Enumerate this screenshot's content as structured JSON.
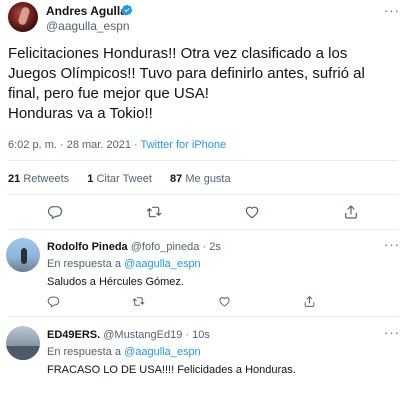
{
  "tweet": {
    "author_name": "Andres Agulla",
    "handle": "@aagulla_espn",
    "text_lines": [
      "Felicitaciones Honduras!! Otra vez clasificado a los",
      "Juegos Olímpicos!! Tuvo para definirlo antes, sufrió al",
      "final, pero fue mejor que USA!",
      "Honduras va a Tokio!!"
    ],
    "time": "6:02 p. m.",
    "date": "28 mar. 2021",
    "source": "Twitter for iPhone",
    "meta_separator": "·",
    "stats": {
      "retweets_count": "21",
      "retweets_label": "Retweets",
      "quotes_count": "1",
      "quotes_label": "Citar Tweet",
      "likes_count": "87",
      "likes_label": "Me gusta"
    },
    "more_glyph": "···"
  },
  "replies": [
    {
      "name": "Rodolfo Pineda",
      "handle": "@fofo_pineda",
      "time": "2s",
      "separator": "·",
      "in_reply_label": "En respuesta a",
      "in_reply_to": "@aagulla_espn",
      "text": "Saludos a Hércules Gómez."
    },
    {
      "name": "ED49ERS.",
      "handle": "@MustangEd19",
      "time": "10s",
      "separator": "·",
      "in_reply_label": "En respuesta a",
      "in_reply_to": "@aagulla_espn",
      "text": "FRACASO LO DE USA!!!! Felicidades a Honduras."
    }
  ],
  "icons": {
    "verified": "verified-badge-icon",
    "reply": "reply-icon",
    "retweet": "retweet-icon",
    "like": "heart-icon",
    "share": "share-icon",
    "more": "more-icon"
  },
  "colors": {
    "accent": "#1d9bf0",
    "text": "#0f1419",
    "secondary": "#536471",
    "divider": "#e6ecf0"
  }
}
